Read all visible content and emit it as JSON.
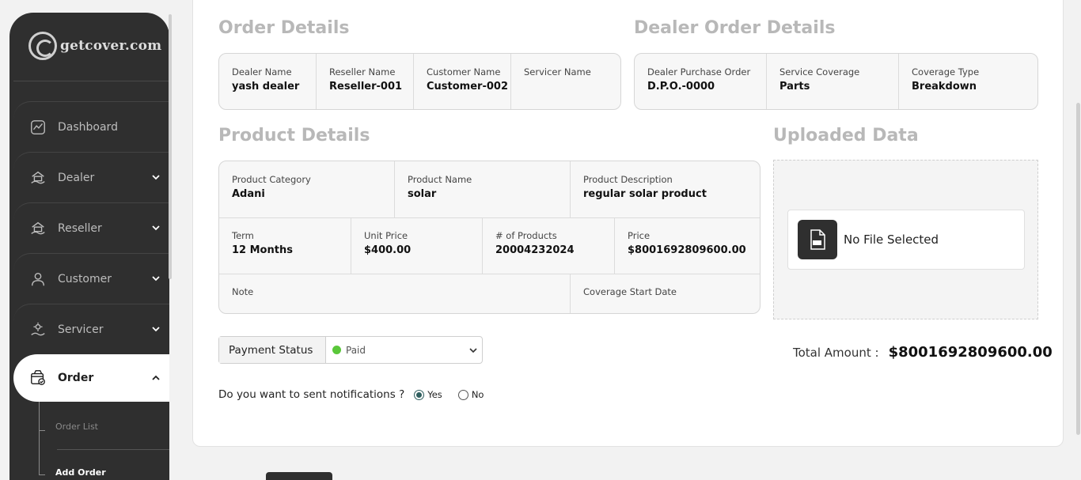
{
  "brand": {
    "logo_text": "getcover.com"
  },
  "sidebar": {
    "items": [
      {
        "label": "Dashboard",
        "icon": "dashboard-icon"
      },
      {
        "label": "Dealer",
        "icon": "dealer-icon"
      },
      {
        "label": "Reseller",
        "icon": "reseller-icon"
      },
      {
        "label": "Customer",
        "icon": "customer-icon"
      },
      {
        "label": "Servicer",
        "icon": "servicer-icon"
      },
      {
        "label": "Order",
        "icon": "order-icon"
      }
    ],
    "sub_items": [
      {
        "label": "Order List"
      },
      {
        "label": "Add Order"
      }
    ]
  },
  "order_details": {
    "title": "Order Details",
    "fields": [
      {
        "label": "Dealer Name",
        "value": "yash dealer"
      },
      {
        "label": "Reseller Name",
        "value": "Reseller-001"
      },
      {
        "label": "Customer Name",
        "value": "Customer-002"
      },
      {
        "label": "Servicer Name",
        "value": ""
      }
    ]
  },
  "dealer_order_details": {
    "title": "Dealer Order Details",
    "fields": [
      {
        "label": "Dealer Purchase Order",
        "value": "D.P.O.-0000"
      },
      {
        "label": "Service Coverage",
        "value": "Parts"
      },
      {
        "label": "Coverage Type",
        "value": "Breakdown"
      }
    ]
  },
  "product_details": {
    "title": "Product Details",
    "row1": [
      {
        "label": "Product Category",
        "value": "Adani"
      },
      {
        "label": "Product Name",
        "value": "solar"
      },
      {
        "label": "Product Description",
        "value": "regular solar product"
      }
    ],
    "row2": [
      {
        "label": "Term",
        "value": "12 Months"
      },
      {
        "label": "Unit Price",
        "value": "$400.00"
      },
      {
        "label": "# of Products",
        "value": "20004232024"
      },
      {
        "label": "Price",
        "value": "$8001692809600.00"
      }
    ],
    "row3": [
      {
        "label": "Note",
        "value": ""
      },
      {
        "label": "Coverage Start Date",
        "value": ""
      }
    ]
  },
  "uploaded_data": {
    "title": "Uploaded Data",
    "file_text": "No File Selected",
    "file_icon": "csv-file-icon"
  },
  "payment": {
    "label": "Payment Status",
    "selected": "Paid",
    "status_color": "#5ac73a"
  },
  "total": {
    "label": "Total Amount :",
    "value": "$8001692809600.00"
  },
  "notifications": {
    "question": "Do you want to sent notifications ?",
    "options": [
      {
        "label": "Yes",
        "checked": true
      },
      {
        "label": "No",
        "checked": false
      }
    ]
  }
}
